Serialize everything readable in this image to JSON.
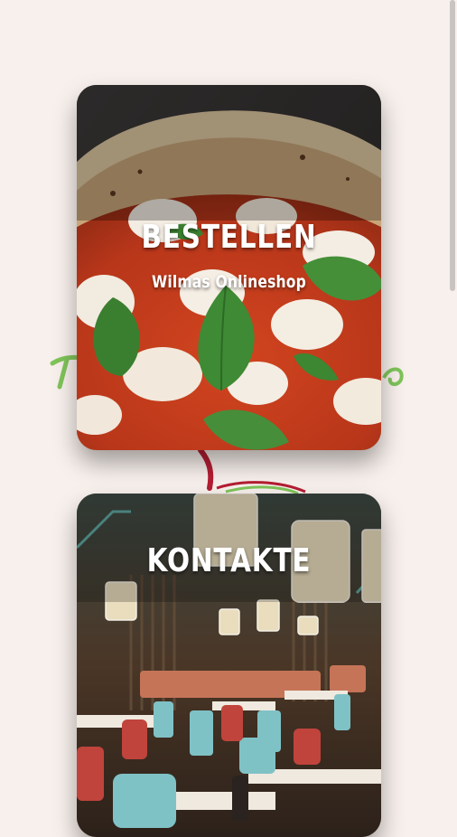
{
  "cards": {
    "order": {
      "title": "BESTELLEN",
      "subtitle": "Wilmas Onlineshop"
    },
    "contact": {
      "title": "KONTAKTE"
    }
  },
  "colors": {
    "page_background": "#f8f0ec",
    "logo_green": "#7fc45a",
    "logo_red": "#b51e33",
    "title_text": "#ffffff"
  },
  "icons": [
    "basil-leaf",
    "pizza-photo",
    "restaurant-interior-photo",
    "logo-flourish"
  ]
}
